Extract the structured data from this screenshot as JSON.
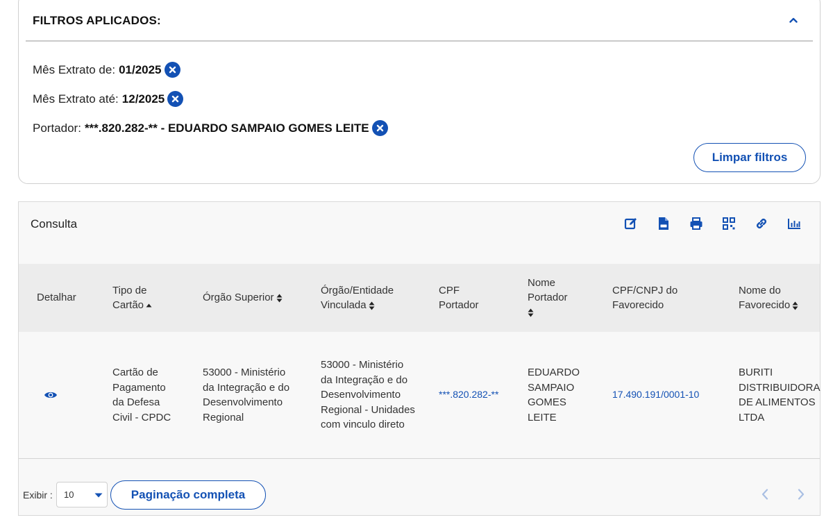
{
  "filters": {
    "title": "FILTROS APLICADOS:",
    "items": [
      {
        "label": "Mês Extrato de:",
        "value": "01/2025"
      },
      {
        "label": "Mês Extrato até:",
        "value": "12/2025"
      },
      {
        "label": "Portador:",
        "value": "***.820.282-** - EDUARDO SAMPAIO GOMES LEITE"
      }
    ],
    "clear_label": "Limpar filtros"
  },
  "results": {
    "title": "Consulta",
    "toolbar": [
      "edit-icon",
      "csv-file-icon",
      "print-icon",
      "qr-code-icon",
      "link-icon",
      "bar-chart-icon"
    ],
    "columns": [
      "Detalhar",
      "Tipo de Cartão",
      "Órgão Superior",
      "Órgão/Entidade Vinculada",
      "CPF Portador",
      "Nome Portador",
      "CPF/CNPJ do Favorecido",
      "Nome do Favorecido"
    ],
    "row": {
      "tipo_cartao": "Cartão de Pagamento da Defesa Civil - CPDC",
      "orgao_superior": "53000 - Ministério da Integração e do Desenvolvimento Regional",
      "orgao_vinculada": "53000 - Ministério da Integração e do Desenvolvimento Regional - Unidades com vinculo direto",
      "cpf_portador": "***.820.282-**",
      "nome_portador": "EDUARDO SAMPAIO GOMES LEITE",
      "cpf_cnpj_favorecido": "17.490.191/0001-10",
      "nome_favorecido": "BURITI DISTRIBUIDORA DE ALIMENTOS LTDA"
    }
  },
  "footer": {
    "show_label": "Exibir :",
    "page_size": "10",
    "full_pagination_label": "Paginação completa"
  },
  "colors": {
    "accent": "#1351b4"
  }
}
